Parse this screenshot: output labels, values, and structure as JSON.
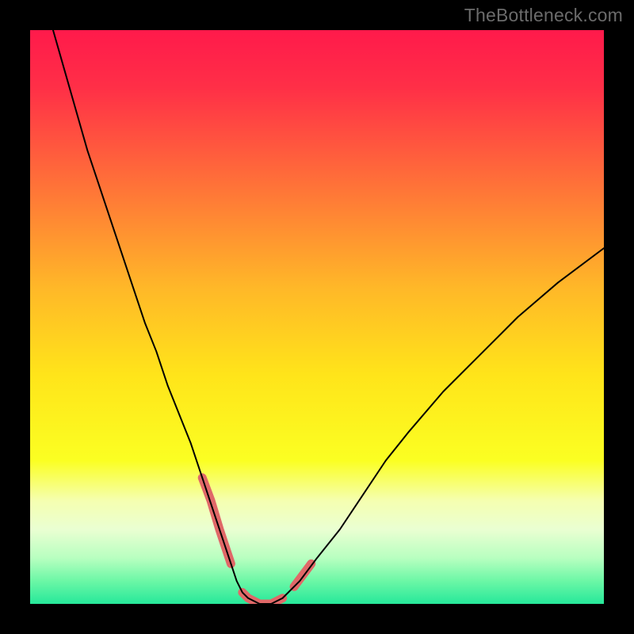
{
  "watermark": "TheBottleneck.com",
  "chart_data": {
    "type": "line",
    "title": "",
    "xlabel": "",
    "ylabel": "",
    "xlim": [
      0,
      100
    ],
    "ylim": [
      0,
      100
    ],
    "grid": false,
    "axes_visible": false,
    "background": {
      "type": "vertical-gradient",
      "stops": [
        {
          "offset": 0.0,
          "color": "#ff1a4b"
        },
        {
          "offset": 0.1,
          "color": "#ff2f47"
        },
        {
          "offset": 0.25,
          "color": "#ff6a3a"
        },
        {
          "offset": 0.45,
          "color": "#ffb828"
        },
        {
          "offset": 0.6,
          "color": "#ffe41a"
        },
        {
          "offset": 0.75,
          "color": "#fbff22"
        },
        {
          "offset": 0.82,
          "color": "#f5ffb0"
        },
        {
          "offset": 0.87,
          "color": "#eaffd2"
        },
        {
          "offset": 0.92,
          "color": "#b8ffc0"
        },
        {
          "offset": 0.96,
          "color": "#6cf7a6"
        },
        {
          "offset": 1.0,
          "color": "#26e89a"
        }
      ]
    },
    "series": [
      {
        "name": "bottleneck-curve",
        "stroke": "#000000",
        "stroke_width": 2,
        "x": [
          4,
          6,
          8,
          10,
          12,
          14,
          16,
          18,
          20,
          22,
          24,
          26,
          28,
          30,
          32,
          34,
          35,
          36,
          37,
          38,
          40,
          42,
          44,
          47,
          50,
          54,
          58,
          62,
          66,
          72,
          78,
          85,
          92,
          100
        ],
        "y": [
          100,
          93,
          86,
          79,
          73,
          67,
          61,
          55,
          49,
          44,
          38,
          33,
          28,
          22,
          16,
          10,
          7,
          4,
          2,
          1,
          0,
          0,
          1,
          4,
          8,
          13,
          19,
          25,
          30,
          37,
          43,
          50,
          56,
          62
        ]
      }
    ],
    "highlight_segments": {
      "stroke": "#e06868",
      "stroke_width": 11,
      "segments": [
        {
          "x": [
            30,
            31.5,
            33,
            34,
            35
          ],
          "y": [
            22,
            18,
            13,
            10,
            7
          ]
        },
        {
          "x": [
            37,
            38,
            40,
            42,
            44
          ],
          "y": [
            2,
            1,
            0,
            0,
            1
          ]
        },
        {
          "x": [
            46,
            47.5,
            49
          ],
          "y": [
            3,
            5,
            7
          ]
        }
      ]
    }
  }
}
